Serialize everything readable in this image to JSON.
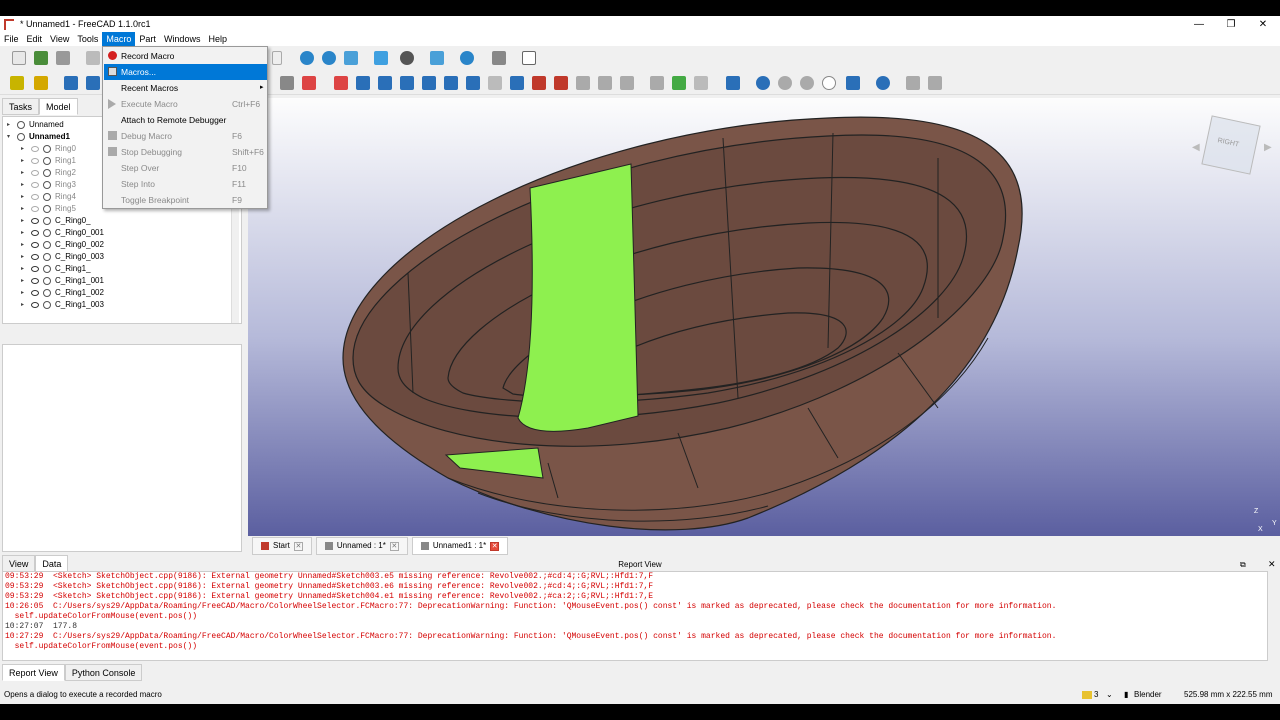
{
  "window": {
    "title": "* Unnamed1 - FreeCAD 1.1.0rc1",
    "minimize": "—",
    "maximize": "❐",
    "close": "✕"
  },
  "menubar": {
    "items": [
      "File",
      "Edit",
      "View",
      "Tools",
      "Macro",
      "Part",
      "Windows",
      "Help"
    ]
  },
  "macro_menu": {
    "items": [
      {
        "label": "Record Macro",
        "shortcut": "",
        "enabled": true
      },
      {
        "label": "Macros...",
        "shortcut": "",
        "enabled": true
      },
      {
        "label": "Recent Macros",
        "shortcut": "",
        "enabled": true,
        "submenu": true
      },
      {
        "label": "Execute Macro",
        "shortcut": "Ctrl+F6",
        "enabled": false
      },
      {
        "label": "Attach to Remote Debugger",
        "shortcut": "",
        "enabled": true
      },
      {
        "label": "Debug Macro",
        "shortcut": "F6",
        "enabled": false
      },
      {
        "label": "Stop Debugging",
        "shortcut": "Shift+F6",
        "enabled": false
      },
      {
        "label": "Step Over",
        "shortcut": "F10",
        "enabled": false
      },
      {
        "label": "Step Into",
        "shortcut": "F11",
        "enabled": false
      },
      {
        "label": "Toggle Breakpoint",
        "shortcut": "F9",
        "enabled": false
      }
    ],
    "highlighted_index": 1
  },
  "left_panel": {
    "tabs": [
      "Tasks",
      "Model"
    ],
    "active_tab": "Model",
    "header_partial": "Mo",
    "tree": [
      {
        "label": "Unnamed",
        "indent": 0,
        "expanded": false,
        "bold": false,
        "visible": null,
        "dim": false
      },
      {
        "label": "Unnamed1",
        "indent": 0,
        "expanded": true,
        "bold": true,
        "visible": null,
        "dim": false
      },
      {
        "label": "Ring0",
        "indent": 1,
        "expanded": false,
        "visible": false,
        "dim": true
      },
      {
        "label": "Ring1",
        "indent": 1,
        "expanded": false,
        "visible": false,
        "dim": true
      },
      {
        "label": "Ring2",
        "indent": 1,
        "expanded": false,
        "visible": false,
        "dim": true
      },
      {
        "label": "Ring3",
        "indent": 1,
        "expanded": false,
        "visible": false,
        "dim": true
      },
      {
        "label": "Ring4",
        "indent": 1,
        "expanded": false,
        "visible": false,
        "dim": true
      },
      {
        "label": "Ring5",
        "indent": 1,
        "expanded": false,
        "visible": false,
        "dim": true
      },
      {
        "label": "C_Ring0_",
        "indent": 1,
        "expanded": false,
        "visible": true,
        "dim": false
      },
      {
        "label": "C_Ring0_001",
        "indent": 1,
        "expanded": false,
        "visible": true,
        "dim": false
      },
      {
        "label": "C_Ring0_002",
        "indent": 1,
        "expanded": false,
        "visible": true,
        "dim": false
      },
      {
        "label": "C_Ring0_003",
        "indent": 1,
        "expanded": false,
        "visible": true,
        "dim": false
      },
      {
        "label": "C_Ring1_",
        "indent": 1,
        "expanded": false,
        "visible": true,
        "dim": false
      },
      {
        "label": "C_Ring1_001",
        "indent": 1,
        "expanded": false,
        "visible": true,
        "dim": false
      },
      {
        "label": "C_Ring1_002",
        "indent": 1,
        "expanded": false,
        "visible": true,
        "dim": false
      },
      {
        "label": "C_Ring1_003",
        "indent": 1,
        "expanded": false,
        "visible": true,
        "dim": false
      }
    ],
    "bottom_tabs": [
      "View",
      "Data"
    ],
    "active_bottom_tab": "Data"
  },
  "viewport": {
    "background_top": "#fdfdfd",
    "background_bottom": "#5b5fa0",
    "body_color": "#7a5548",
    "highlight_color": "#8ef04f",
    "navcube_face": "RIGHT",
    "axis_labels": [
      "Z",
      "Y",
      "X"
    ]
  },
  "doc_tabs": [
    {
      "label": "Start",
      "active": false
    },
    {
      "label": "Unnamed : 1*",
      "active": false
    },
    {
      "label": "Unnamed1 : 1*",
      "active": true
    }
  ],
  "report": {
    "title": "Report View",
    "lines": [
      {
        "text": "09:53:29  <Sketch> SketchObject.cpp(9186): External geometry Unnamed#Sketch003.e5 missing reference: Revolve002.;#cd:4;:G;RVL;:Hfd1:7,F",
        "type": "err"
      },
      {
        "text": "09:53:29  <Sketch> SketchObject.cpp(9186): External geometry Unnamed#Sketch003.e6 missing reference: Revolve002.;#cd:4;:G;RVL;:Hfd1:7,F",
        "type": "err"
      },
      {
        "text": "09:53:29  <Sketch> SketchObject.cpp(9186): External geometry Unnamed#Sketch004.e1 missing reference: Revolve002.;#ca:2;:G;RVL;:Hfd1:7,E",
        "type": "err"
      },
      {
        "text": "10:26:05  C:/Users/sys29/AppData/Roaming/FreeCAD/Macro/ColorWheelSelector.FCMacro:77: DeprecationWarning: Function: 'QMouseEvent.pos() const' is marked as deprecated, please check the documentation for more information.",
        "type": "err"
      },
      {
        "text": "  self.updateColorFromMouse(event.pos())",
        "type": "err"
      },
      {
        "text": "10:27:07  177.8",
        "type": "ok"
      },
      {
        "text": "10:27:29  C:/Users/sys29/AppData/Roaming/FreeCAD/Macro/ColorWheelSelector.FCMacro:77: DeprecationWarning: Function: 'QMouseEvent.pos() const' is marked as deprecated, please check the documentation for more information.",
        "type": "err"
      },
      {
        "text": "  self.updateColorFromMouse(event.pos())",
        "type": "err"
      }
    ],
    "tabs": [
      "Report View",
      "Python Console"
    ],
    "active_tab": "Report View"
  },
  "statusbar": {
    "message": "Opens a dialog to execute a recorded macro",
    "selection_count": "3",
    "nav_style": "Blender",
    "dimensions": "525.98 mm x 222.55 mm"
  }
}
